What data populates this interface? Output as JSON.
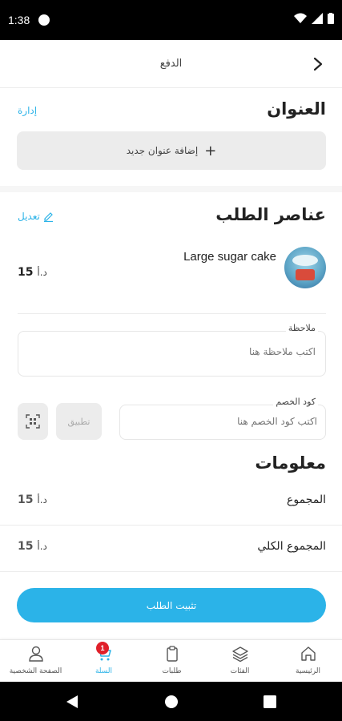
{
  "status_bar": {
    "time": "1:38"
  },
  "header": {
    "title": "الدفع"
  },
  "address": {
    "title": "العنوان",
    "manage_label": "إدارة",
    "add_label": "إضافة عنوان جديد"
  },
  "order_items": {
    "title": "عناصر الطلب",
    "edit_label": "تعديل",
    "items": [
      {
        "name": "Large sugar cake",
        "price": "15",
        "currency": "د.أ"
      }
    ]
  },
  "note": {
    "label": "ملاحظة",
    "placeholder": "اكتب ملاحظة هنا"
  },
  "coupon": {
    "label": "كود الخصم",
    "placeholder": "اكتب كود الخصم هنا",
    "apply_label": "تطبيق"
  },
  "info": {
    "title": "معلومات",
    "subtotal_label": "المجموع",
    "subtotal_value": "15",
    "total_label": "المجموع الكلي",
    "total_value": "15",
    "currency": "د.أ"
  },
  "confirm_label": "تثبيت الطلب",
  "bottom_nav": {
    "home": "الرئيسية",
    "categories": "الفئات",
    "orders": "طلبات",
    "cart": "السلة",
    "cart_badge": "1",
    "profile": "الصفحة الشخصية"
  },
  "colors": {
    "accent": "#2bb3e8",
    "badge": "#e0202a"
  }
}
